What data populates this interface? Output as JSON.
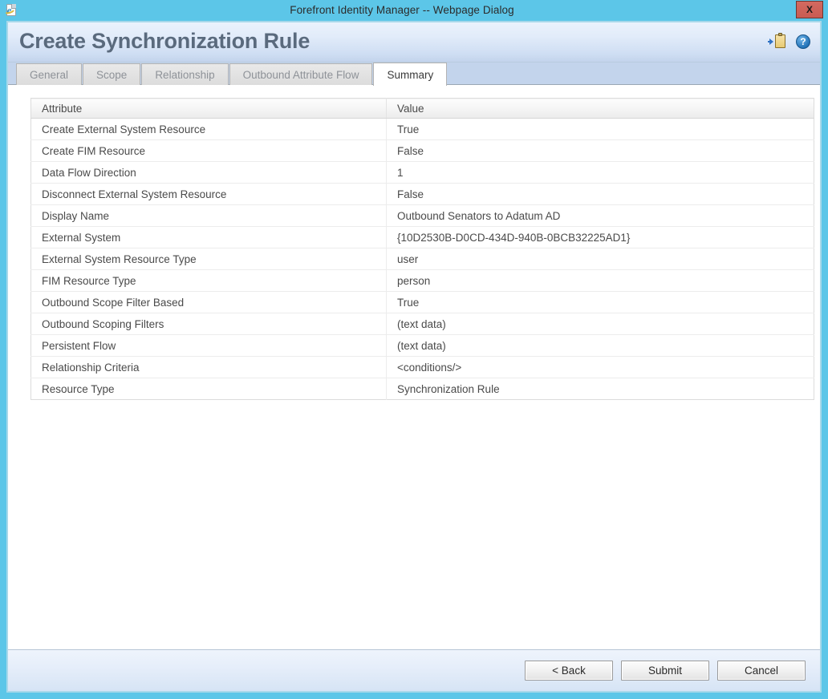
{
  "window": {
    "title": "Forefront Identity Manager -- Webpage Dialog",
    "icon": "ie-page-icon",
    "close_label": "X"
  },
  "header": {
    "title": "Create Synchronization Rule",
    "actions": [
      {
        "name": "export-to-clipboard-icon",
        "label": ""
      },
      {
        "name": "help-icon",
        "label": "?"
      }
    ]
  },
  "tabs": [
    {
      "label": "General",
      "active": false
    },
    {
      "label": "Scope",
      "active": false
    },
    {
      "label": "Relationship",
      "active": false
    },
    {
      "label": "Outbound Attribute Flow",
      "active": false
    },
    {
      "label": "Summary",
      "active": true
    }
  ],
  "table": {
    "columns": [
      "Attribute",
      "Value"
    ],
    "rows": [
      {
        "attribute": "Create External System Resource",
        "value": "True"
      },
      {
        "attribute": "Create FIM Resource",
        "value": "False"
      },
      {
        "attribute": "Data Flow Direction",
        "value": "1"
      },
      {
        "attribute": "Disconnect External System Resource",
        "value": "False"
      },
      {
        "attribute": "Display Name",
        "value": "Outbound Senators to Adatum AD"
      },
      {
        "attribute": "External System",
        "value": "{10D2530B-D0CD-434D-940B-0BCB32225AD1}"
      },
      {
        "attribute": "External System Resource Type",
        "value": "user"
      },
      {
        "attribute": "FIM Resource Type",
        "value": "person"
      },
      {
        "attribute": "Outbound Scope Filter Based",
        "value": "True"
      },
      {
        "attribute": "Outbound Scoping Filters",
        "value": "(text data)"
      },
      {
        "attribute": "Persistent Flow",
        "value": "(text data)"
      },
      {
        "attribute": "Relationship Criteria",
        "value": "<conditions/>"
      },
      {
        "attribute": "Resource Type",
        "value": "Synchronization Rule"
      }
    ]
  },
  "footer": {
    "buttons": [
      {
        "name": "back-button",
        "label": "< Back"
      },
      {
        "name": "submit-button",
        "label": "Submit"
      },
      {
        "name": "cancel-button",
        "label": "Cancel"
      }
    ]
  },
  "colors": {
    "titlebar": "#5cc6e8",
    "close_button": "#c95b52",
    "header_gradient_top": "#eaf2fc",
    "header_gradient_bottom": "#c3d4ec",
    "title_text": "#5a6a7d",
    "tabstrip": "#c3d4ec",
    "tab_inactive_text": "#8e9298",
    "table_text": "#4a4a4a",
    "frame_border": "#a8d8ea"
  }
}
